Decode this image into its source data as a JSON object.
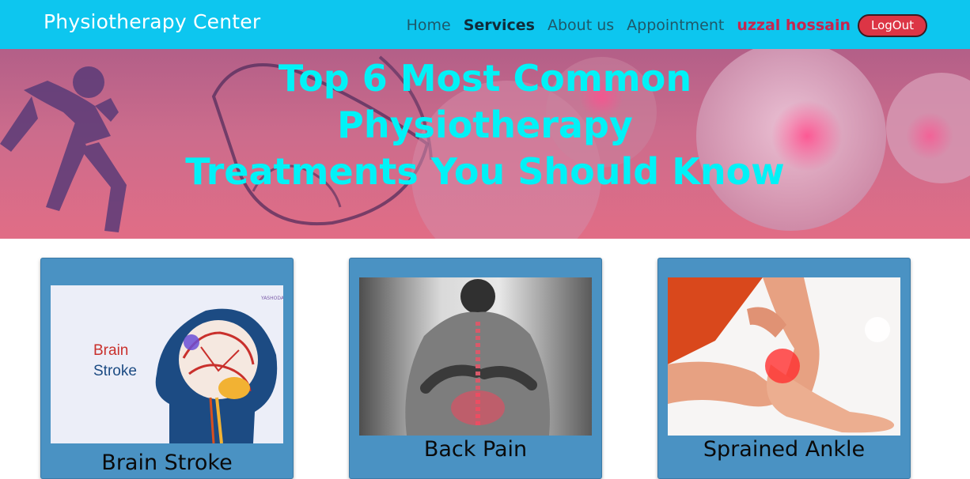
{
  "navbar": {
    "brand": "Physiotherapy Center",
    "links": [
      {
        "label": "Home"
      },
      {
        "label": "Services",
        "active": true
      },
      {
        "label": "About us"
      },
      {
        "label": "Appointment"
      }
    ],
    "user_name": "uzzal hossain",
    "logout_label": "LogOut"
  },
  "hero": {
    "title_line1": "Top 6 Most Common",
    "title_line2": "Physiotherapy",
    "title_line3": "Treatments You Should Know"
  },
  "cards": [
    {
      "title": "Brain Stroke",
      "image_text_1": "Brain",
      "image_text_2": "Stroke",
      "image_logo": "YASHODA HOSPITALS"
    },
    {
      "title": "Back Pain"
    },
    {
      "title": "Sprained Ankle"
    }
  ],
  "colors": {
    "navbar_bg": "#0dc6ef",
    "hero_text": "#00f2f7",
    "card_bg": "#4a92c3",
    "logout_bg": "#dc3545",
    "user_name": "#c8254e"
  }
}
